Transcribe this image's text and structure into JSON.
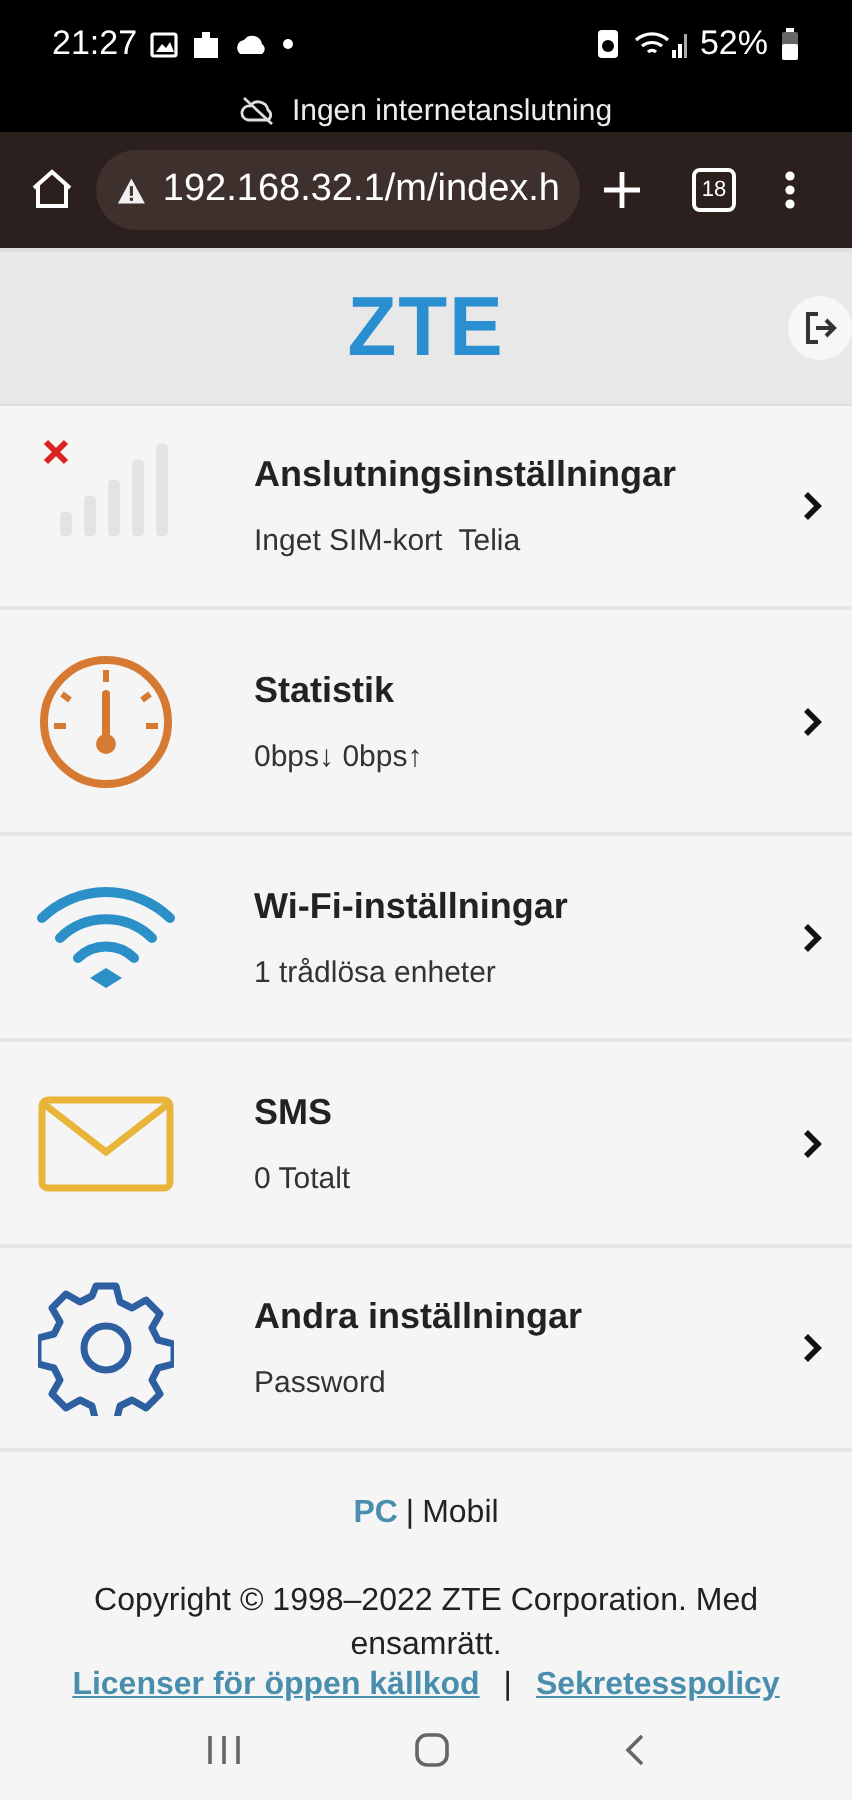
{
  "status_bar": {
    "time": "21:27",
    "battery": "52%",
    "notice": "Ingen internetanslutning"
  },
  "browser": {
    "url": "192.168.32.1/m/index.h",
    "tab_count": "18"
  },
  "header": {
    "logo": "ZTE"
  },
  "menu": [
    {
      "kind": "signal",
      "title": "Anslutningsinställningar",
      "subtitle": "Inget SIM-kort  Telia"
    },
    {
      "kind": "gauge",
      "title": "Statistik",
      "subtitle": "0bps↓ 0bps↑"
    },
    {
      "kind": "wifi",
      "title": "Wi-Fi-inställningar",
      "subtitle": "1 trådlösa enheter"
    },
    {
      "kind": "mail",
      "title": "SMS",
      "subtitle": "0 Totalt"
    },
    {
      "kind": "gear",
      "title": "Andra inställningar",
      "subtitle": "Password"
    }
  ],
  "footer": {
    "view_switch": [
      {
        "label": "PC",
        "selected": false
      },
      {
        "label": "Mobil",
        "selected": true
      }
    ],
    "separator": "|",
    "copyright": "Copyright © 1998–2022 ZTE Corporation. Med ensamrätt.",
    "links": [
      "Licenser för öppen källkod",
      "Sekretesspolicy"
    ],
    "link_separator": "|"
  }
}
